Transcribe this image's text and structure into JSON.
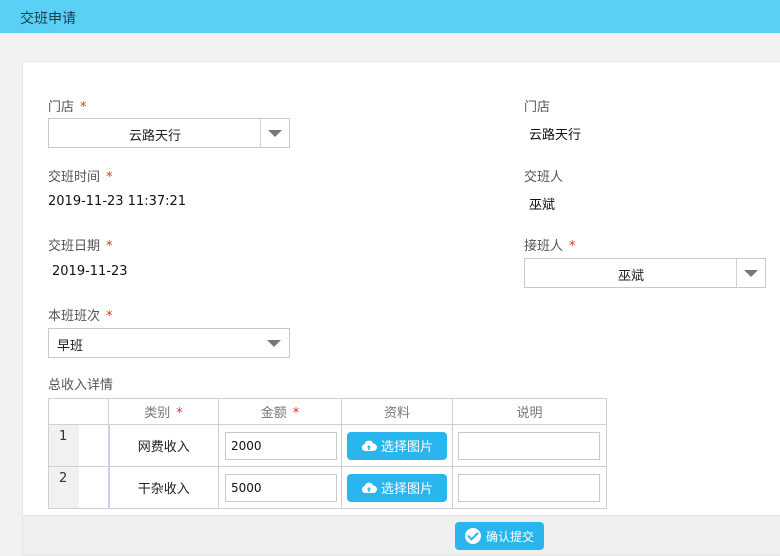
{
  "header": {
    "title": "交班申请"
  },
  "form": {
    "store": {
      "label": "门店",
      "required": "*",
      "selected": "云路天行"
    },
    "store_display": {
      "label": "门店",
      "value": "云路天行"
    },
    "handover_time": {
      "label": "交班时间",
      "required": "*",
      "value": "2019-11-23 11:37:21"
    },
    "handover_person": {
      "label": "交班人",
      "value": "巫斌"
    },
    "handover_date": {
      "label": "交班日期",
      "required": "*",
      "value": "2019-11-23"
    },
    "receiver": {
      "label": "接班人",
      "required": "*",
      "selected": "巫斌"
    },
    "shift": {
      "label": "本班班次",
      "required": "*",
      "selected": "早班"
    },
    "income_section": {
      "label": "总收入详情"
    }
  },
  "income_table": {
    "columns": [
      {
        "label": "类别",
        "required": "*"
      },
      {
        "label": "金额",
        "required": "*"
      },
      {
        "label": "资料",
        "required": ""
      },
      {
        "label": "说明",
        "required": ""
      }
    ],
    "rows": [
      {
        "index": "1",
        "category": "网费收入",
        "amount": "2000",
        "upload_label": "选择图片",
        "note": ""
      },
      {
        "index": "2",
        "category": "干杂收入",
        "amount": "5000",
        "upload_label": "选择图片",
        "note": ""
      }
    ]
  },
  "footer": {
    "submit_label": "确认提交"
  },
  "colors": {
    "header_bg": "#5bd0f6",
    "accent": "#29b6ee",
    "required": "#e0302a"
  },
  "icons": {
    "upload": "cloud-upload-icon",
    "submit": "check-circle-icon",
    "dropdown": "chevron-down-icon"
  }
}
